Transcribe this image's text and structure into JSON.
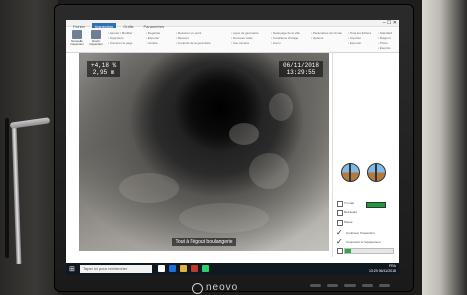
{
  "app": {
    "tabs": [
      "Fichier",
      "Inspection",
      "Outils",
      "Paramètres"
    ],
    "active_tab": 1,
    "ribbon": {
      "big_buttons": [
        "Nouvelle inspection",
        "Ouvrir inspection"
      ],
      "group1": [
        "Ajouter / Modifier",
        "Supprimer",
        "Imprimer la page"
      ],
      "group2": [
        "Regarder",
        "Exporter",
        "Joindre"
      ],
      "group3": [
        "Dessiner un point",
        "Mesurer",
        "Contrôle de la géométrie"
      ],
      "group4": [
        "Ligne de géométrie",
        "Données vidéo",
        "Vue caméra"
      ],
      "group5": [
        "Nettoyage de la ville",
        "Conditions d'image",
        "Zoom"
      ],
      "group6": [
        "Paramètres de l'écran",
        "Options"
      ],
      "group7": [
        "Tous les fichiers",
        "Importer",
        "Exporter"
      ],
      "group8": [
        "Standard",
        "Rapport",
        "Photo",
        "Étendre"
      ]
    }
  },
  "video": {
    "osd_left": [
      "+4,18 %",
      "2,95 m"
    ],
    "osd_right": [
      "06/11/2018",
      "13:29:55"
    ],
    "caption": "Tout à l'égout boulangerie"
  },
  "panel": {
    "opt1": "Tri mail",
    "opt2": "Retraçant",
    "opt3": "Pause",
    "opt4": "Continuer l'inspection",
    "opt5": "Connexion à l'équipement",
    "progress": 0.12
  },
  "taskbar": {
    "search_placeholder": "Taper ici pour rechercher",
    "tray": [
      "FRA",
      "13:29",
      "06/11/2018"
    ]
  },
  "monitor": {
    "brand": "neovo"
  },
  "colors": {
    "accent": "#2f6fb5",
    "taskbar": "#101820",
    "status_green": "#1f9a3a"
  }
}
